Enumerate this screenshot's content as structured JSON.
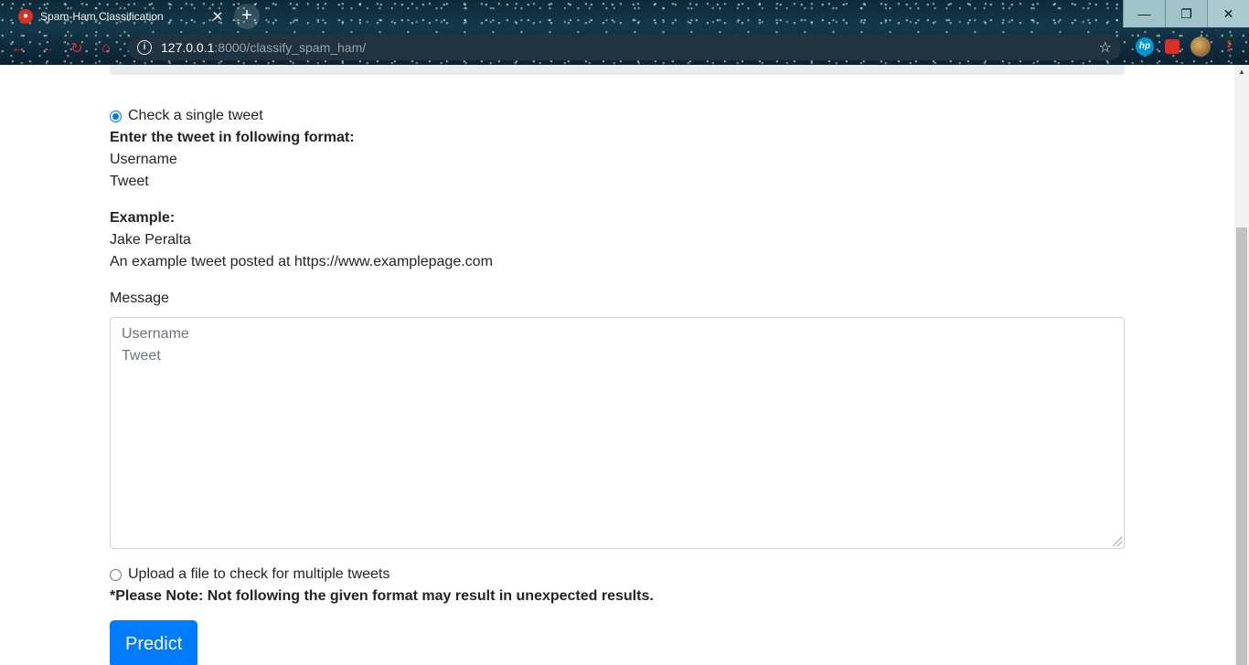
{
  "browser": {
    "tab_title": "Spam-Ham Classification",
    "tab_close": "✕",
    "new_tab": "+",
    "url_host": "127.0.0.1",
    "url_path": ":8000/classify_spam_ham/",
    "window_controls": {
      "minimize": "—",
      "maximize": "❐",
      "close": "✕"
    },
    "nav": {
      "back": "←",
      "forward": "→",
      "reload": "↻",
      "home": "⌂"
    },
    "star": "☆",
    "ext_hp": "hp",
    "menu": "⋮"
  },
  "form": {
    "single_option_label": "Check a single tweet",
    "format_heading": "Enter the tweet in following format:",
    "format_line1": "Username",
    "format_line2": "Tweet",
    "example_heading": "Example:",
    "example_line1": "Jake Peralta",
    "example_line2": "An example tweet posted at https://www.examplepage.com",
    "message_label": "Message",
    "message_placeholder_line1": "Username",
    "message_placeholder_line2": "Tweet",
    "upload_option_label": "Upload a file to check for multiple tweets",
    "note": "*Please Note: Not following the given format may result in unexpected results.",
    "predict_label": "Predict",
    "single_selected": true
  },
  "colors": {
    "primary": "#007bff",
    "radio_checked": "#0075ff"
  }
}
